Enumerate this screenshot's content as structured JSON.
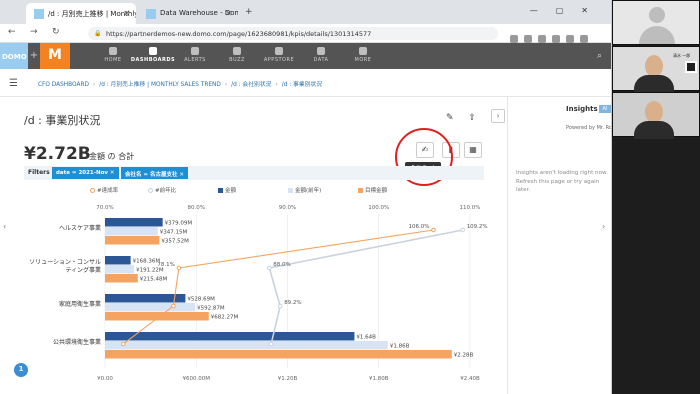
{
  "browser": {
    "tabs": [
      {
        "label": "/d : 月別売上推移 | Monthly Sales",
        "active": true
      },
      {
        "label": "Data Warehouse - Domo",
        "active": false
      }
    ],
    "new_tab": "+",
    "url": "https://partnerdemos-new.domo.com/page/1623680981/kpis/details/1301314577"
  },
  "domo_nav": {
    "logo": "DOMO",
    "plus": "+",
    "app_logo": "M",
    "items": [
      "HOME",
      "DASHBOARDS",
      "ALERTS",
      "BUZZ",
      "APPSTORE",
      "DATA",
      "MORE"
    ],
    "active": "DASHBOARDS"
  },
  "breadcrumb": [
    "CFO DASHBOARD",
    "/d : 月別売上推移 | MONTHLY SALES TREND",
    "/d : 会社別状況",
    "/d : 事業別状況"
  ],
  "card": {
    "title": "/d : 事業別状況",
    "summary_value": "¥2.72B",
    "summary_label": "金額 の 合計",
    "tooltip": "Edit Card"
  },
  "filters": {
    "label": "Filters",
    "chips": [
      "date = 2021-Nov",
      "会社名 = 名古屋支社"
    ]
  },
  "colors": {
    "kin": "#2b5797",
    "kin_prev": "#d6e4f5",
    "target": "#f4a460",
    "rate_line": "#f4a460",
    "yoy_line": "#c8d3df",
    "chip": "#1e8fd3"
  },
  "chart_data": {
    "type": "bar",
    "orientation": "horizontal",
    "categories": [
      "ヘルスケア事業",
      "ソリューション・コンサルティング事業",
      "家庭用衛生事業",
      "公共環境衛生事業"
    ],
    "category_display": [
      [
        "ヘルスケア事業"
      ],
      [
        "ソリューション・コンサル",
        "ティング事業"
      ],
      [
        "家庭用衛生事業"
      ],
      [
        "公共環境衛生事業"
      ]
    ],
    "legend": [
      "#達成率",
      "#前年比",
      "金額",
      "金額(前年)",
      "目標金額"
    ],
    "series": [
      {
        "name": "金額",
        "values": [
          379.09,
          168.36,
          528.69,
          1640
        ],
        "labels": [
          "¥379.09M",
          "¥168.36M",
          "¥528.69M",
          "¥1.64B"
        ]
      },
      {
        "name": "金額(前年)",
        "values": [
          347.15,
          191.22,
          592.87,
          1860
        ],
        "labels": [
          "¥347.15M",
          "¥191.22M",
          "¥592.87M",
          "¥1.86B"
        ]
      },
      {
        "name": "目標金額",
        "values": [
          357.52,
          215.48,
          682.27,
          2280
        ],
        "labels": [
          "¥357.52M",
          "¥215.48M",
          "¥682.27M",
          "¥2.28B"
        ]
      }
    ],
    "lines": [
      {
        "name": "#達成率",
        "values": [
          106.0,
          78.1,
          77.5,
          72.0
        ],
        "labels": [
          "106.0%",
          "78.1%",
          "",
          ""
        ]
      },
      {
        "name": "#前年比",
        "values": [
          109.2,
          88.0,
          89.2,
          88.2
        ],
        "labels": [
          "109.2%",
          "88.0%",
          "89.2%",
          ""
        ]
      }
    ],
    "x_axis": {
      "ticks": [
        "¥0.00",
        "¥600.00M",
        "¥1.20B",
        "¥1.80B",
        "¥2.40B"
      ],
      "range": [
        0,
        2400
      ]
    },
    "x2_axis": {
      "ticks": [
        "70.0%",
        "80.0%",
        "90.0%",
        "100.0%",
        "110.0%"
      ],
      "range": [
        70,
        110
      ]
    }
  },
  "insights": {
    "title": "Insights",
    "badge": "AI",
    "powered": "Powered by Mr. Ro",
    "message": "Insights aren't loading right now. Refresh this page or try again later."
  },
  "help": "1",
  "participants": [
    {
      "kind": "avatar"
    },
    {
      "kind": "camera",
      "name": "清水 一郎",
      "qr": true
    },
    {
      "kind": "camera"
    }
  ]
}
